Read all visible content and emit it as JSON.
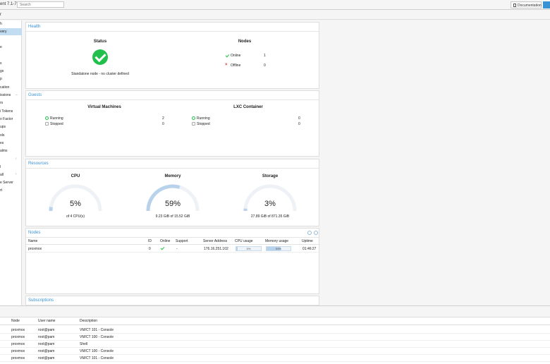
{
  "topbar": {
    "version": "ent 7.1-7",
    "search_placeholder": "Search",
    "documentation_label": "Documentation"
  },
  "subheader": {
    "label": "r"
  },
  "sidebar": {
    "items": [
      {
        "label": "h",
        "active": false
      },
      {
        "label": "very",
        "active": true
      },
      {
        "label": "e",
        "active": false
      },
      {
        "label": "s",
        "active": false
      },
      {
        "label": "gs",
        "active": false
      },
      {
        "label": "p",
        "active": false
      },
      {
        "label": "cation",
        "active": false
      },
      {
        "label": "issions",
        "active": false
      },
      {
        "label": "rs",
        "active": false
      },
      {
        "label": "i Tokens",
        "active": false
      },
      {
        "label": "o Factor",
        "active": false
      },
      {
        "label": "ups",
        "active": false
      },
      {
        "label": "ols",
        "active": false
      },
      {
        "label": "es",
        "active": false
      },
      {
        "label": "alms",
        "active": false
      },
      {
        "label": "l",
        "active": false
      },
      {
        "label": "all",
        "active": false
      },
      {
        "label": "e Server",
        "active": false
      },
      {
        "label": "rt",
        "active": false
      }
    ]
  },
  "health": {
    "title": "Health",
    "status_heading": "Status",
    "status_text": "Standalone node - no cluster defined",
    "nodes_heading": "Nodes",
    "online_label": "Online",
    "online_count": "1",
    "offline_label": "Offline",
    "offline_count": "0"
  },
  "guests": {
    "title": "Guests",
    "vm_heading": "Virtual Machines",
    "vm_running_label": "Running",
    "vm_running_count": "2",
    "vm_stopped_label": "Stopped",
    "vm_stopped_count": "0",
    "lxc_heading": "LXC Container",
    "lxc_running_label": "Running",
    "lxc_running_count": "0",
    "lxc_stopped_label": "Stopped",
    "lxc_stopped_count": "0"
  },
  "resources": {
    "title": "Resources",
    "cpu": {
      "heading": "CPU",
      "percent_label": "5%",
      "value": 5,
      "detail": "of 4 CPU(s)"
    },
    "memory": {
      "heading": "Memory",
      "percent_label": "59%",
      "value": 59,
      "detail": "9.23 GiB of 15.52 GiB"
    },
    "storage": {
      "heading": "Storage",
      "percent_label": "3%",
      "value": 3,
      "detail": "27.89 GiB of 871.35 GiB"
    }
  },
  "nodes_grid": {
    "title": "Nodes",
    "columns": [
      "Name",
      "ID",
      "Online",
      "Support",
      "Server Address",
      "CPU usage",
      "Memory usage",
      "Uptime"
    ],
    "rows": [
      {
        "name": "proxmox",
        "id": "0",
        "support": "-",
        "address": "176.16.251.102",
        "cpu_label": "5%",
        "cpu_value": 5,
        "mem_label": "59%",
        "mem_value": 59,
        "uptime": "01:46:27"
      }
    ]
  },
  "subscriptions": {
    "title": "Subscriptions"
  },
  "tasks": {
    "columns": [
      "Node",
      "User name",
      "Description"
    ],
    "rows": [
      {
        "node": "proxmox",
        "user": "root@pam",
        "desc": "VM/CT 101 - Console"
      },
      {
        "node": "proxmox",
        "user": "root@pam",
        "desc": "VM/CT 100 - Console"
      },
      {
        "node": "proxmox",
        "user": "root@pam",
        "desc": "Shell"
      },
      {
        "node": "proxmox",
        "user": "root@pam",
        "desc": "VM/CT 100 - Console"
      },
      {
        "node": "proxmox",
        "user": "root@pam",
        "desc": "VM/CT 101 - Console"
      }
    ]
  },
  "colors": {
    "accent": "#3892d4",
    "success": "#21bf4b",
    "danger": "#d43f3a",
    "gauge_fill": "#b7d2ea",
    "gauge_track": "#eef2f6"
  }
}
